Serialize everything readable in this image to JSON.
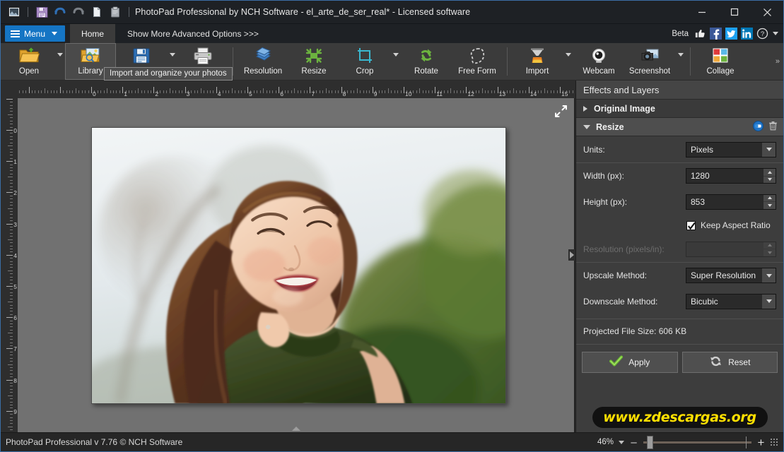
{
  "window": {
    "title": "PhotoPad Professional by NCH Software - el_arte_de_ser_real* - Licensed software",
    "app_icon": "photopad-app-icon",
    "quick_access": [
      {
        "name": "save-icon",
        "label": "Save"
      },
      {
        "name": "undo-icon",
        "label": "Undo"
      },
      {
        "name": "redo-icon",
        "label": "Redo"
      },
      {
        "name": "copy-icon",
        "label": "Copy"
      },
      {
        "name": "paste-icon",
        "label": "Paste"
      }
    ],
    "controls": {
      "minimize": "–",
      "maximize": "□",
      "close": "✕"
    }
  },
  "menubar": {
    "menu_label": "Menu",
    "tab_home": "Home",
    "advanced_options": "Show More Advanced Options >>>",
    "beta_label": "Beta",
    "social": [
      {
        "name": "thumbs-up-icon",
        "label": "Like"
      },
      {
        "name": "facebook-icon",
        "label": "Facebook"
      },
      {
        "name": "twitter-icon",
        "label": "Twitter"
      },
      {
        "name": "linkedin-icon",
        "label": "LinkedIn"
      }
    ],
    "help_label": "Help"
  },
  "ribbon": {
    "overflow_label": "»",
    "items": [
      {
        "label": "Open",
        "icon": "open-folder-icon",
        "dropdown": true,
        "selected": false
      },
      {
        "label": "Library",
        "icon": "library-icon",
        "dropdown": false,
        "selected": true
      },
      {
        "label": "Save",
        "icon": "save-disk-icon",
        "dropdown": true,
        "selected": false
      },
      {
        "label": "Print",
        "icon": "printer-icon",
        "dropdown": false,
        "selected": false
      },
      {
        "label": "Resolution",
        "icon": "resolution-icon",
        "dropdown": false,
        "selected": false
      },
      {
        "label": "Resize",
        "icon": "resize-icon",
        "dropdown": false,
        "selected": false
      },
      {
        "label": "Crop",
        "icon": "crop-icon",
        "dropdown": true,
        "selected": false
      },
      {
        "label": "Rotate",
        "icon": "rotate-icon",
        "dropdown": false,
        "selected": false
      },
      {
        "label": "Free Form",
        "icon": "free-form-icon",
        "dropdown": false,
        "selected": false
      },
      {
        "label": "Import",
        "icon": "import-icon",
        "dropdown": true,
        "selected": false
      },
      {
        "label": "Webcam",
        "icon": "webcam-icon",
        "dropdown": false,
        "selected": false
      },
      {
        "label": "Screenshot",
        "icon": "screenshot-icon",
        "dropdown": true,
        "selected": false
      },
      {
        "label": "Collage",
        "icon": "collage-icon",
        "dropdown": false,
        "selected": false
      }
    ],
    "tooltip": "Import and organize your photos"
  },
  "rulers": {
    "horizontal_labels": [
      "0",
      "1",
      "2",
      "3",
      "4",
      "5",
      "6",
      "7",
      "8",
      "9",
      "10",
      "11",
      "12",
      "13",
      "14",
      "15"
    ],
    "vertical_labels": [
      "0",
      "1",
      "2",
      "3",
      "4",
      "5",
      "6",
      "7",
      "8",
      "9"
    ]
  },
  "canvas": {
    "expand_icon": "expand-arrows-icon",
    "collapse_panel_icon": "collapse-panel-icon",
    "scroll_up_icon": "scroll-up-triangle-icon"
  },
  "panel": {
    "title": "Effects and Layers",
    "sections": [
      {
        "name": "original-image",
        "label": "Original Image",
        "expanded": false
      },
      {
        "name": "resize",
        "label": "Resize",
        "expanded": true
      }
    ],
    "section_tools": [
      {
        "name": "visibility-toggle-icon",
        "label": "Toggle visibility"
      },
      {
        "name": "delete-layer-icon",
        "label": "Delete"
      }
    ],
    "resize": {
      "units_label": "Units:",
      "units_value": "Pixels",
      "width_label": "Width (px):",
      "width_value": "1280",
      "height_label": "Height (px):",
      "height_value": "853",
      "keep_aspect_label": "Keep Aspect Ratio",
      "keep_aspect_checked": true,
      "resolution_label": "Resolution (pixels/in):",
      "resolution_value": "",
      "resolution_disabled": true,
      "upscale_label": "Upscale Method:",
      "upscale_value": "Super Resolution",
      "downscale_label": "Downscale Method:",
      "downscale_value": "Bicubic",
      "projected_size": "Projected File Size: 606 KB",
      "apply_label": "Apply",
      "reset_label": "Reset"
    },
    "watermark": "www.zdescargas.org"
  },
  "statusbar": {
    "text": "PhotoPad Professional v 7.76 © NCH Software",
    "zoom_percent": "46%",
    "zoom_out_label": "–",
    "zoom_in_label": "+"
  },
  "colors": {
    "accent_blue": "#1575c4",
    "titlebar_bg": "#1e2125",
    "ribbon_bg": "#3b3b3b",
    "panel_bg": "#3d3d3d",
    "canvas_bg": "#717171",
    "watermark_yellow": "#ffe000",
    "apply_green": "#6fbf33"
  }
}
